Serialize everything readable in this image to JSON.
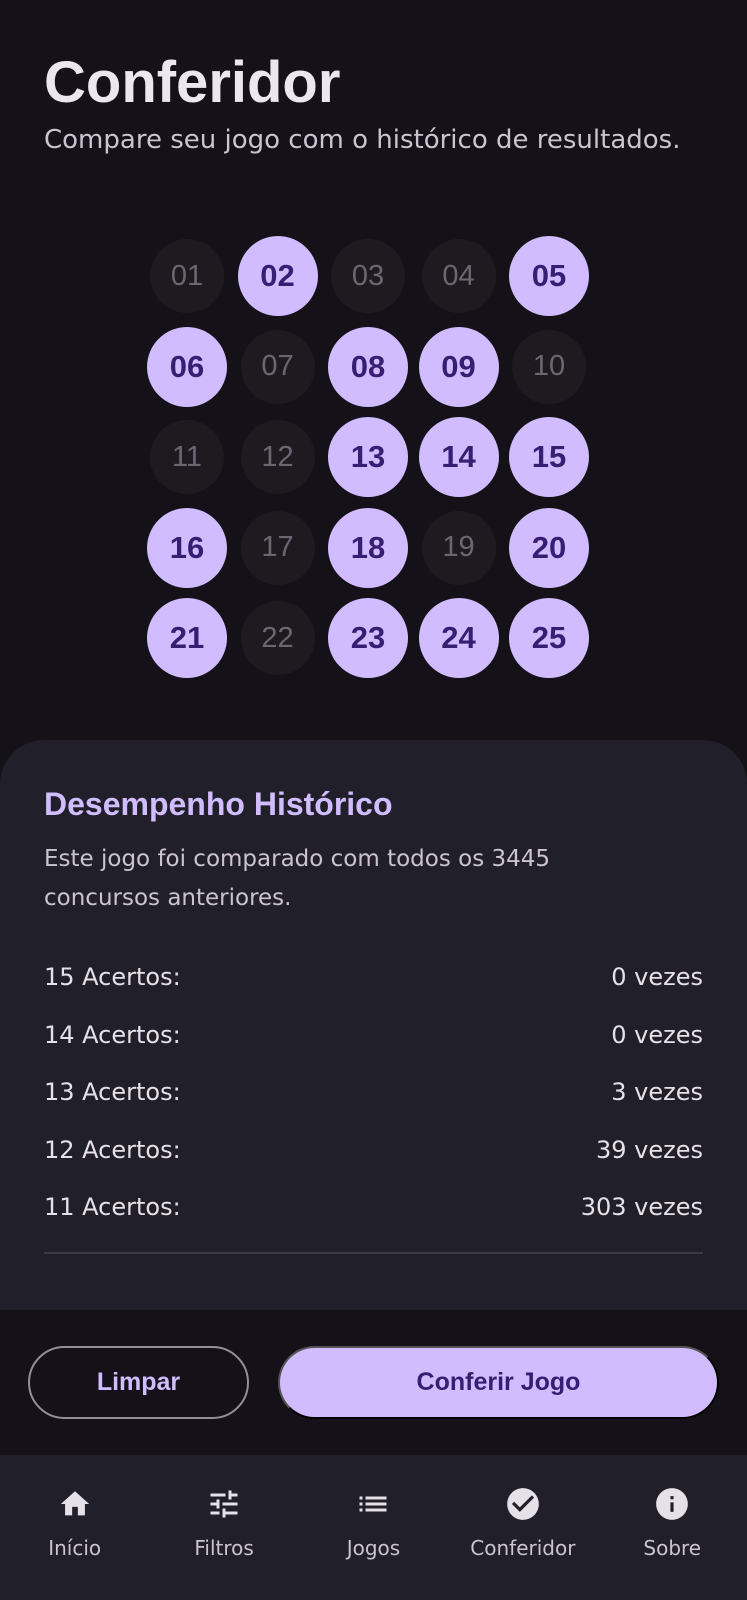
{
  "header": {
    "title": "Conferidor",
    "subtitle": "Compare seu jogo com o histórico de resultados."
  },
  "numbers": [
    {
      "label": "01",
      "selected": false
    },
    {
      "label": "02",
      "selected": true
    },
    {
      "label": "03",
      "selected": false
    },
    {
      "label": "04",
      "selected": false
    },
    {
      "label": "05",
      "selected": true
    },
    {
      "label": "06",
      "selected": true
    },
    {
      "label": "07",
      "selected": false
    },
    {
      "label": "08",
      "selected": true
    },
    {
      "label": "09",
      "selected": true
    },
    {
      "label": "10",
      "selected": false
    },
    {
      "label": "11",
      "selected": false
    },
    {
      "label": "12",
      "selected": false
    },
    {
      "label": "13",
      "selected": true
    },
    {
      "label": "14",
      "selected": true
    },
    {
      "label": "15",
      "selected": true
    },
    {
      "label": "16",
      "selected": true
    },
    {
      "label": "17",
      "selected": false
    },
    {
      "label": "18",
      "selected": true
    },
    {
      "label": "19",
      "selected": false
    },
    {
      "label": "20",
      "selected": true
    },
    {
      "label": "21",
      "selected": true
    },
    {
      "label": "22",
      "selected": false
    },
    {
      "label": "23",
      "selected": true
    },
    {
      "label": "24",
      "selected": true
    },
    {
      "label": "25",
      "selected": true
    }
  ],
  "performance": {
    "title": "Desempenho Histórico",
    "description": "Este jogo foi comparado com todos os 3445 concursos anteriores.",
    "rows": [
      {
        "label": "15 Acertos:",
        "value": "0 vezes"
      },
      {
        "label": "14 Acertos:",
        "value": "0 vezes"
      },
      {
        "label": "13 Acertos:",
        "value": "3 vezes"
      },
      {
        "label": "12 Acertos:",
        "value": "39 vezes"
      },
      {
        "label": "11 Acertos:",
        "value": "303 vezes"
      }
    ]
  },
  "actions": {
    "clear_label": "Limpar",
    "check_label": "Conferir Jogo"
  },
  "nav": {
    "items": [
      {
        "label": "Início",
        "icon": "home-icon"
      },
      {
        "label": "Filtros",
        "icon": "tune-icon"
      },
      {
        "label": "Jogos",
        "icon": "list-icon"
      },
      {
        "label": "Conferidor",
        "icon": "check-circle-icon"
      },
      {
        "label": "Sobre",
        "icon": "info-icon"
      }
    ]
  },
  "colors": {
    "background": "#141218",
    "surface": "#211f29",
    "accent": "#d0bcff",
    "on_accent": "#381e72"
  }
}
